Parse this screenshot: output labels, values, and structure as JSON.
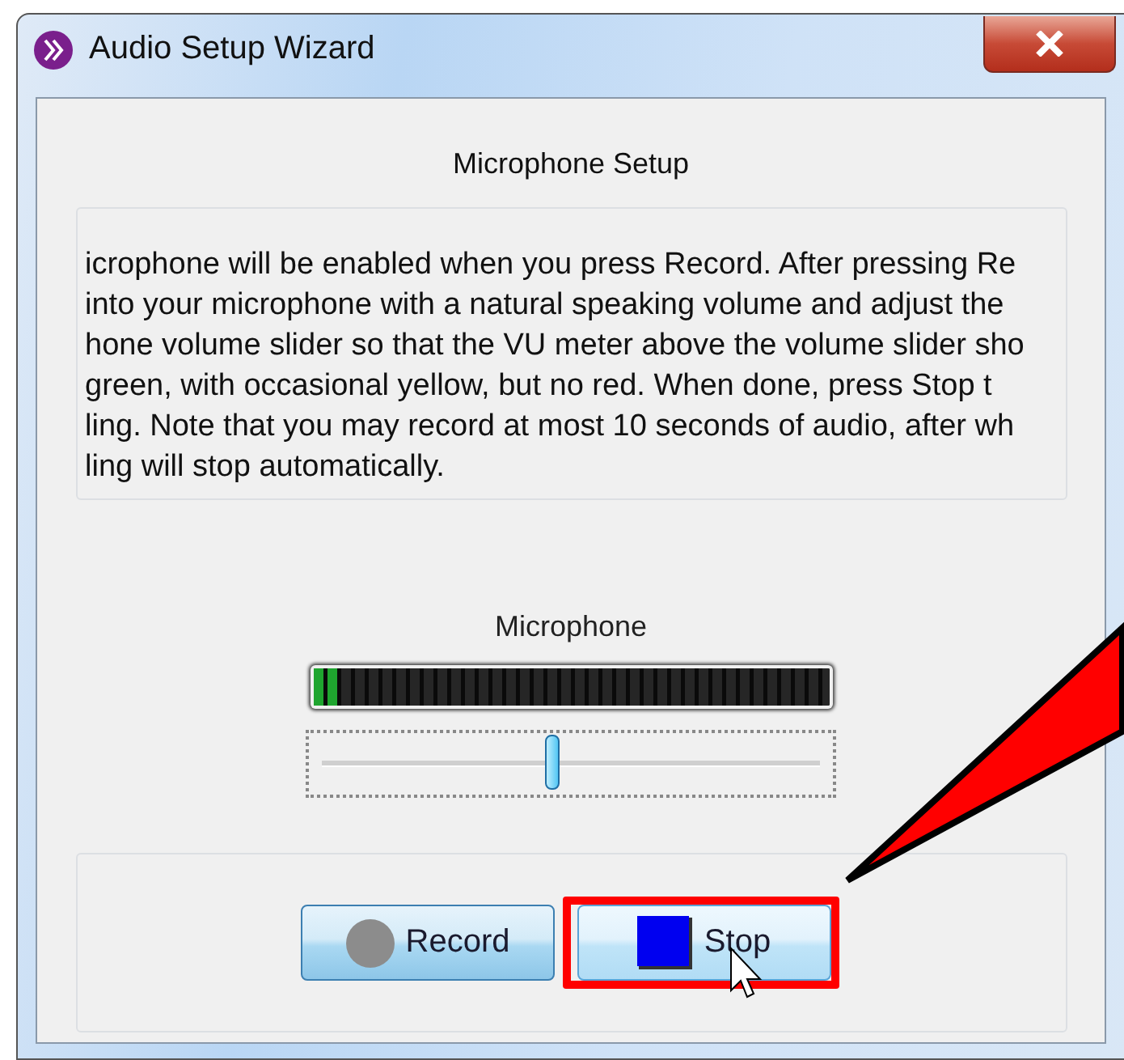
{
  "window": {
    "title": "Audio Setup Wizard"
  },
  "page": {
    "heading": "Microphone Setup",
    "instructions": [
      "icrophone will be enabled when you press Record. After pressing Re",
      "into your microphone with a natural speaking volume and adjust the",
      "hone volume slider so that the VU meter above the volume slider sho",
      "green, with occasional yellow, but no red. When done, press Stop t",
      "ling. Note that you may record at most 10 seconds of audio, after wh",
      "ling will stop automatically."
    ]
  },
  "microphone": {
    "label": "Microphone",
    "meter": {
      "level": 0.05
    },
    "volume": {
      "level": 0.46
    }
  },
  "buttons": [
    {
      "kind": "record",
      "label": "Record",
      "highlighted": false
    },
    {
      "kind": "stop",
      "label": "Stop",
      "highlighted": true
    }
  ]
}
